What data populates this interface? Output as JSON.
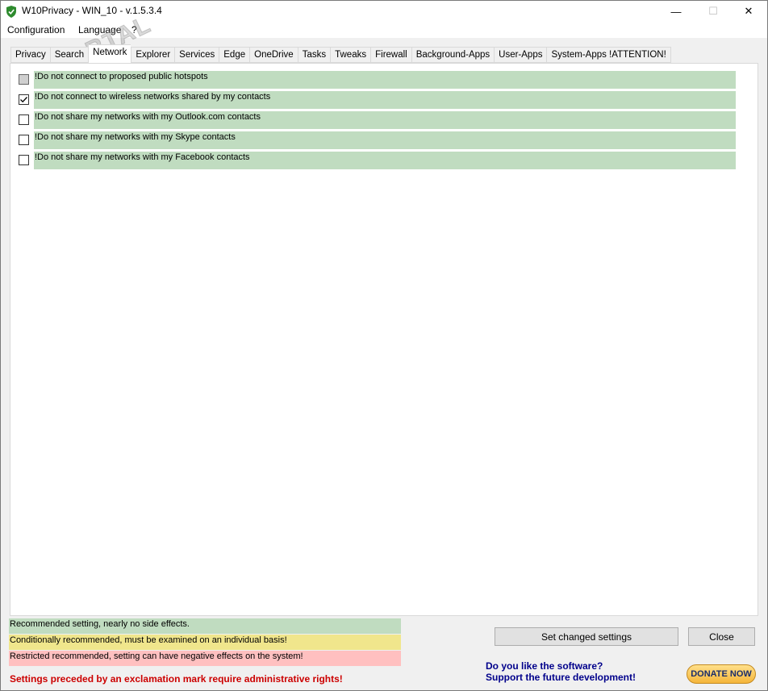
{
  "window": {
    "title": "W10Privacy - WIN_10 - v.1.5.3.4",
    "controls": {
      "minimize": "—",
      "maximize": "☐",
      "close": "✕"
    }
  },
  "menu": [
    "Configuration",
    "Language",
    "?"
  ],
  "tabs": [
    {
      "label": "Privacy"
    },
    {
      "label": "Search"
    },
    {
      "label": "Network",
      "active": true
    },
    {
      "label": "Explorer"
    },
    {
      "label": "Services"
    },
    {
      "label": "Edge"
    },
    {
      "label": "OneDrive"
    },
    {
      "label": "Tasks"
    },
    {
      "label": "Tweaks"
    },
    {
      "label": "Firewall"
    },
    {
      "label": "Background-Apps"
    },
    {
      "label": "User-Apps"
    },
    {
      "label": "System-Apps !ATTENTION!"
    }
  ],
  "settings": [
    {
      "label": "!Do not connect to proposed public hotspots",
      "state": "indeterminate"
    },
    {
      "label": "!Do not connect to wireless networks shared by my contacts",
      "state": "checked"
    },
    {
      "label": "!Do not share my networks with my Outlook.com contacts",
      "state": "unchecked"
    },
    {
      "label": "!Do not share my networks with my Skype contacts",
      "state": "unchecked"
    },
    {
      "label": "!Do not share my networks with my Facebook contacts",
      "state": "unchecked"
    }
  ],
  "legend": {
    "green": "Recommended setting, nearly no side effects.",
    "yellow": "Conditionally recommended, must be examined on an individual basis!",
    "red": "Restricted recommended, setting can have negative effects on the system!"
  },
  "warning": "Settings preceded by an exclamation mark require administrative rights!",
  "buttons": {
    "set_changed": "Set changed settings",
    "close": "Close"
  },
  "donate": {
    "line1": "Do you like the software?",
    "line2": "Support the future development!",
    "button": "DONATE NOW"
  },
  "watermark": "PORTAL",
  "colors": {
    "recommended": "#c0dcc0",
    "conditional": "#f0e68c",
    "restricted": "#ffc0c0",
    "warning": "#cc0000",
    "donate_text": "#00008b"
  }
}
